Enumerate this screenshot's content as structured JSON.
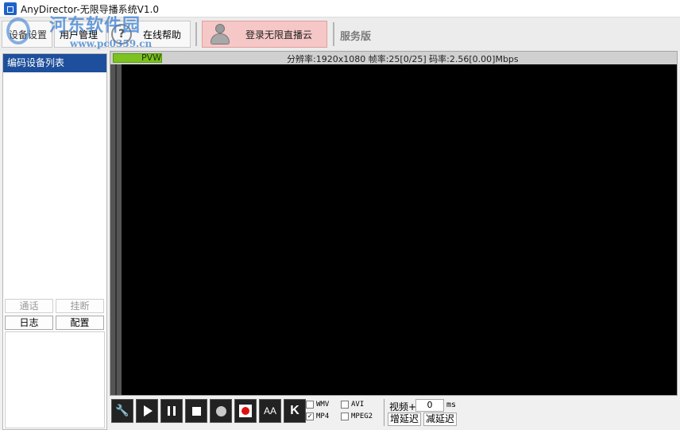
{
  "window": {
    "title": "AnyDirector-无限导播系统V1.0"
  },
  "watermark": {
    "text": "河东软件园",
    "url": "www.pc0359.cn"
  },
  "toolbar": {
    "device_settings": "设备设置",
    "user_management": "用户管理",
    "online_help": "在线帮助",
    "help_icon_glyph": "?",
    "login_cloud": "登录无限直播云",
    "edition": "服务版"
  },
  "left_panel": {
    "header": "编码设备列表",
    "call": "通话",
    "hang_up": "挂断",
    "log": "日志",
    "config": "配置"
  },
  "preview": {
    "badge": "PVW",
    "stats": "分辨率:1920x1080 帧率:25[0/25] 码率:2.56[0.00]Mbps"
  },
  "controls": {
    "aa_glyph": "AA",
    "k_glyph": "K",
    "formats": {
      "wmv": {
        "label": "WMV",
        "checked": false
      },
      "mp4": {
        "label": "MP4",
        "checked": true
      },
      "avi": {
        "label": "AVI",
        "checked": false
      },
      "mpeg2": {
        "label": "MPEG2",
        "checked": false
      }
    },
    "check_glyph": "✓",
    "video_label": "视频+",
    "delay_value": "0",
    "ms_label": "ms",
    "increase_delay": "增延迟",
    "decrease_delay": "减延迟"
  },
  "colors": {
    "header_blue": "#1e4f9c",
    "login_pink": "#f6c7c7",
    "pvw_green": "#7cc220",
    "record_red": "#e01010"
  }
}
